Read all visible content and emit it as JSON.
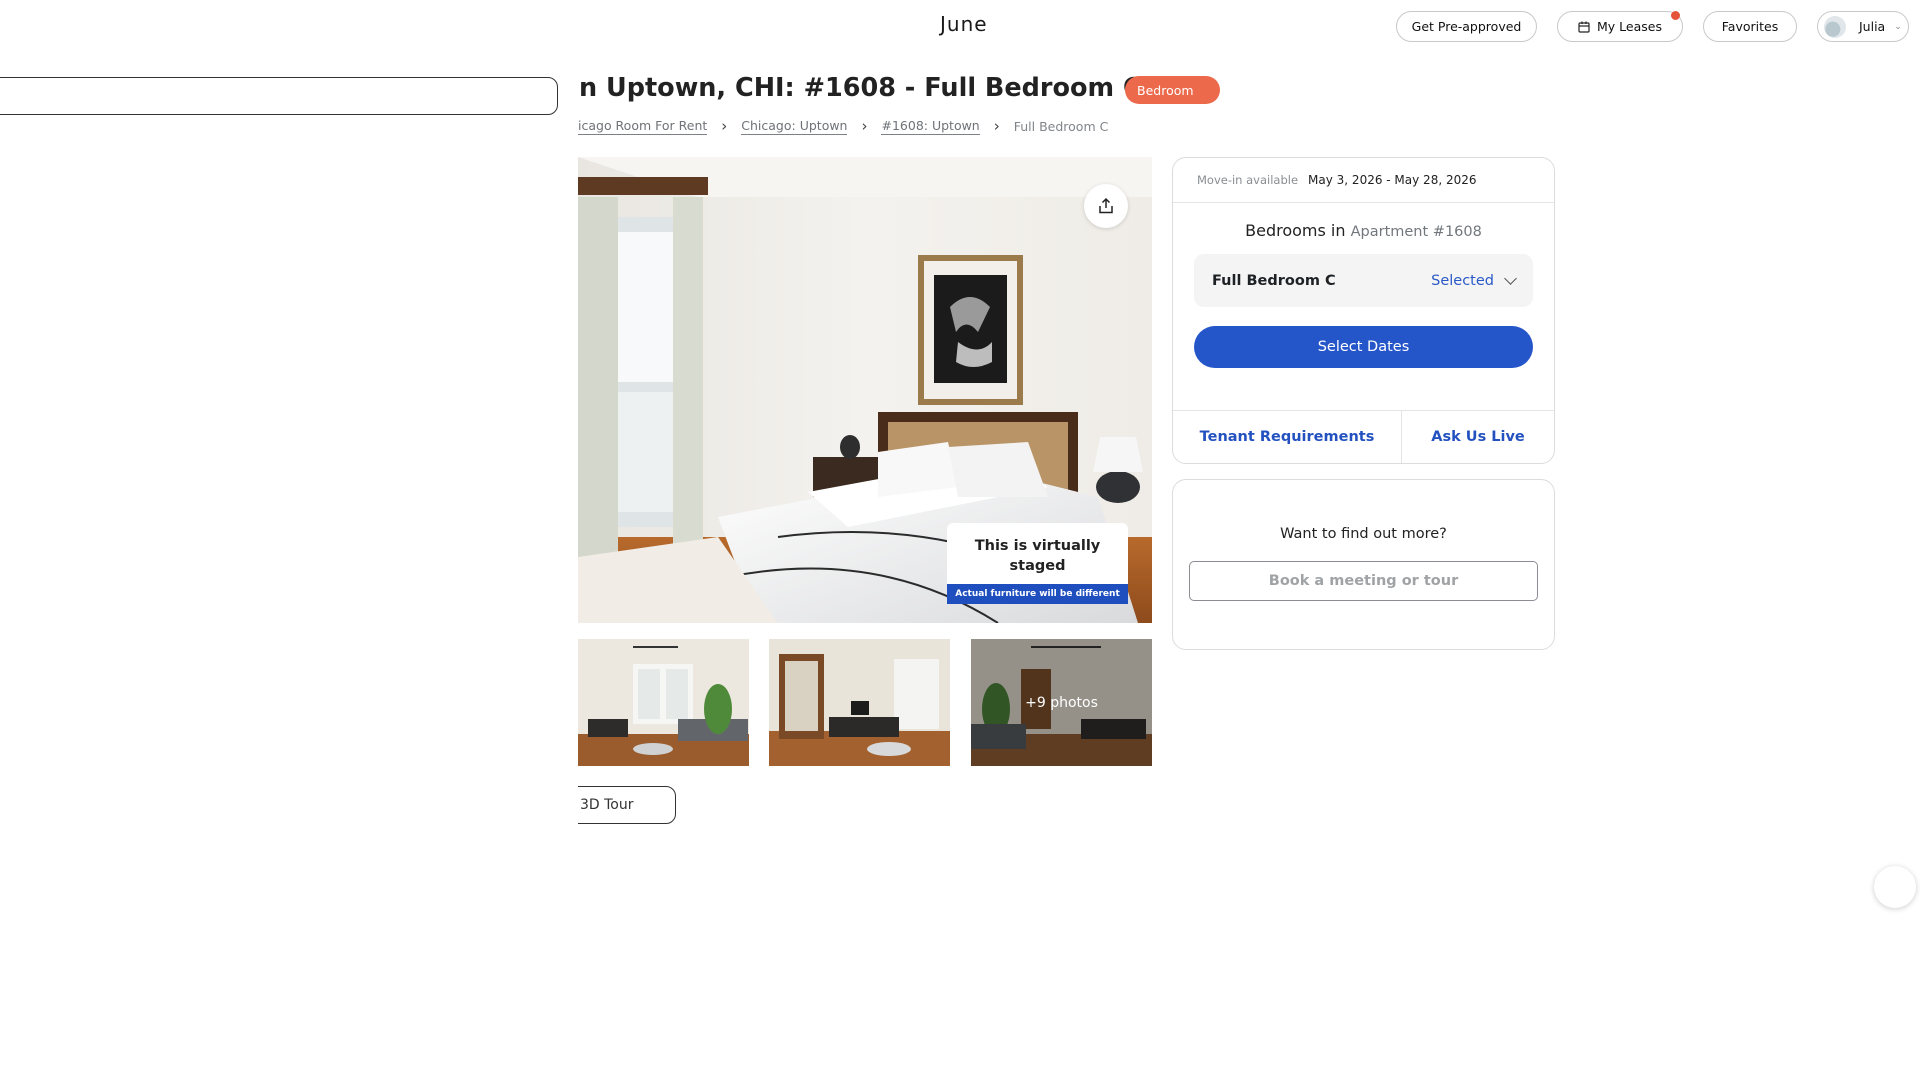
{
  "header": {
    "logo": "June",
    "preapproved_label": "Get Pre-approved",
    "leases_label": "My Leases",
    "favorites_label": "Favorites",
    "user_name": "Julia"
  },
  "listing": {
    "title": "n Uptown, CHI: #1608 - Full Bedroom C",
    "badge": "Bedroom",
    "breadcrumb": [
      "icago Room For Rent",
      "Chicago: Uptown",
      "#1608: Uptown",
      "Full Bedroom C"
    ],
    "staged_title": "This is virtually staged",
    "staged_note": "Actual furniture will be different",
    "more_photos": "+9 photos",
    "tour_label": "3D Tour"
  },
  "booking": {
    "movein_label": "Move-in available",
    "movein_value": "May 3, 2026 - May 28, 2026",
    "bedrooms_in": "Bedrooms in",
    "apartment": "Apartment #1608",
    "room_name": "Full Bedroom C",
    "room_status": "Selected",
    "select_dates": "Select Dates",
    "tenant_requirements": "Tenant Requirements",
    "ask_us_live": "Ask Us Live"
  },
  "more": {
    "question": "Want to find out more?",
    "book_placeholder": "Book a meeting or tour"
  },
  "colors": {
    "accent": "#2455c9",
    "badge": "#ec6a4b",
    "notification": "#e4533a"
  }
}
